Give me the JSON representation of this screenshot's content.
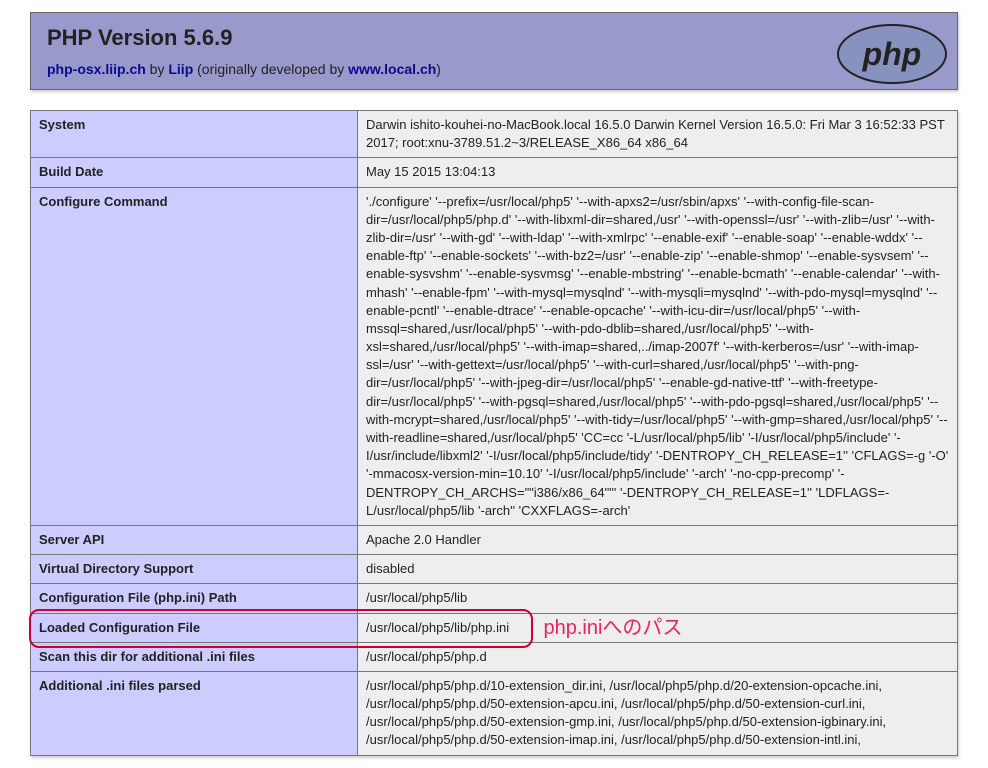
{
  "header": {
    "title": "PHP Version 5.6.9",
    "link1_text": "php-osx.liip.ch",
    "by_text": " by ",
    "link2_text": "Liip",
    "mid_text": " (originally developed by ",
    "link3_text": "www.local.ch",
    "end_text": ")"
  },
  "rows": [
    {
      "key": "System",
      "val": "Darwin ishito-kouhei-no-MacBook.local 16.5.0 Darwin Kernel Version 16.5.0: Fri Mar 3 16:52:33 PST 2017; root:xnu-3789.51.2~3/RELEASE_X86_64 x86_64"
    },
    {
      "key": "Build Date",
      "val": "May 15 2015 13:04:13"
    },
    {
      "key": "Configure Command",
      "val": "'./configure' '--prefix=/usr/local/php5' '--with-apxs2=/usr/sbin/apxs' '--with-config-file-scan-dir=/usr/local/php5/php.d' '--with-libxml-dir=shared,/usr' '--with-openssl=/usr' '--with-zlib=/usr' '--with-zlib-dir=/usr' '--with-gd' '--with-ldap' '--with-xmlrpc' '--enable-exif' '--enable-soap' '--enable-wddx' '--enable-ftp' '--enable-sockets' '--with-bz2=/usr' '--enable-zip' '--enable-shmop' '--enable-sysvsem' '--enable-sysvshm' '--enable-sysvmsg' '--enable-mbstring' '--enable-bcmath' '--enable-calendar' '--with-mhash' '--enable-fpm' '--with-mysql=mysqlnd' '--with-mysqli=mysqlnd' '--with-pdo-mysql=mysqlnd' '--enable-pcntl' '--enable-dtrace' '--enable-opcache' '--with-icu-dir=/usr/local/php5' '--with-mssql=shared,/usr/local/php5' '--with-pdo-dblib=shared,/usr/local/php5' '--with-xsl=shared,/usr/local/php5' '--with-imap=shared,../imap-2007f' '--with-kerberos=/usr' '--with-imap-ssl=/usr' '--with-gettext=/usr/local/php5' '--with-curl=shared,/usr/local/php5' '--with-png-dir=/usr/local/php5' '--with-jpeg-dir=/usr/local/php5' '--enable-gd-native-ttf' '--with-freetype-dir=/usr/local/php5' '--with-pgsql=shared,/usr/local/php5' '--with-pdo-pgsql=shared,/usr/local/php5' '--with-mcrypt=shared,/usr/local/php5' '--with-tidy=/usr/local/php5' '--with-gmp=shared,/usr/local/php5' '--with-readline=shared,/usr/local/php5' 'CC=cc '-L/usr/local/php5/lib' '-I/usr/local/php5/include' '-I/usr/include/libxml2' '-I/usr/local/php5/include/tidy' '-DENTROPY_CH_RELEASE=1'' 'CFLAGS=-g '-O' '-mmacosx-version-min=10.10' '-I/usr/local/php5/include' '-arch' '-no-cpp-precomp' '-DENTROPY_CH_ARCHS=\"\"i386/x86_64\"\"' '-DENTROPY_CH_RELEASE=1'' 'LDFLAGS=-L/usr/local/php5/lib '-arch'' 'CXXFLAGS=-arch'"
    },
    {
      "key": "Server API",
      "val": "Apache 2.0 Handler"
    },
    {
      "key": "Virtual Directory Support",
      "val": "disabled"
    },
    {
      "key": "Configuration File (php.ini) Path",
      "val": "/usr/local/php5/lib"
    },
    {
      "key": "Loaded Configuration File",
      "val": "/usr/local/php5/lib/php.ini"
    },
    {
      "key": "Scan this dir for additional .ini files",
      "val": "/usr/local/php5/php.d"
    },
    {
      "key": "Additional .ini files parsed",
      "val": "/usr/local/php5/php.d/10-extension_dir.ini, /usr/local/php5/php.d/20-extension-opcache.ini, /usr/local/php5/php.d/50-extension-apcu.ini, /usr/local/php5/php.d/50-extension-curl.ini, /usr/local/php5/php.d/50-extension-gmp.ini, /usr/local/php5/php.d/50-extension-igbinary.ini, /usr/local/php5/php.d/50-extension-imap.ini, /usr/local/php5/php.d/50-extension-intl.ini,"
    }
  ],
  "annotation": {
    "label": "php.iniへのパス"
  }
}
